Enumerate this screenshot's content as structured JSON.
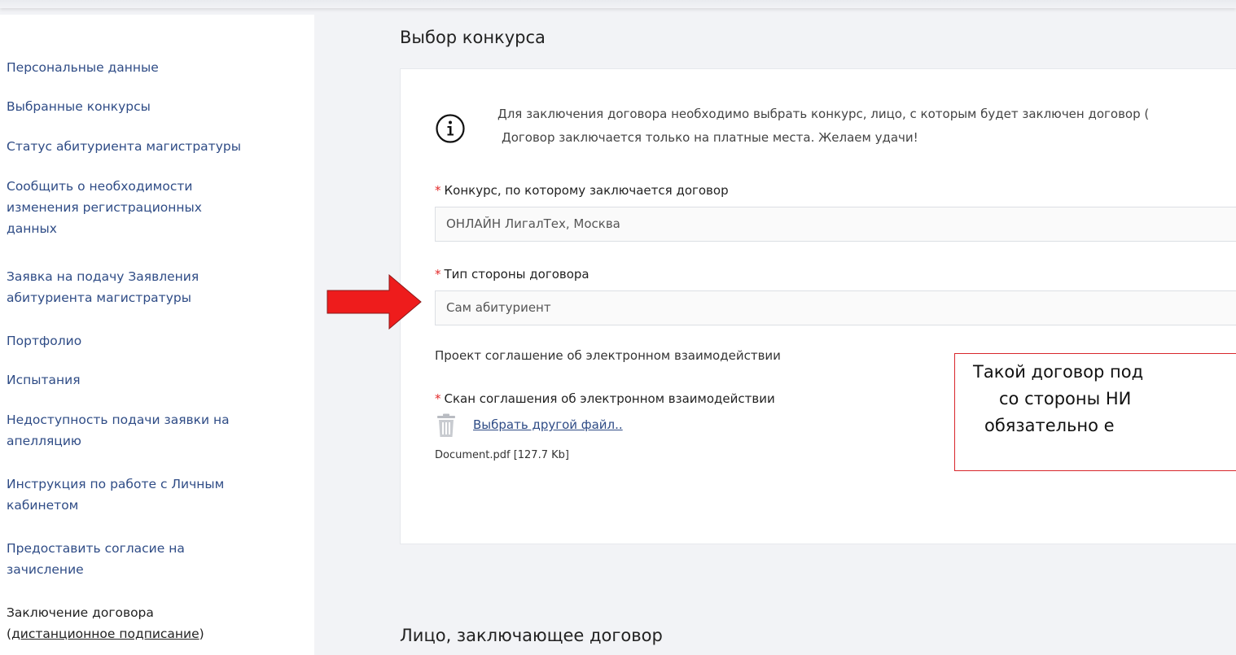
{
  "sidebar": {
    "items": [
      {
        "label": "Персональные данные"
      },
      {
        "label": "Выбранные конкурсы"
      },
      {
        "label": "Статус абитуриента магистратуры"
      },
      {
        "lines": [
          "Сообщить о необходимости",
          "изменения регистрационных",
          "данных"
        ]
      },
      {
        "lines": [
          "Заявка на подачу Заявления",
          "абитуриента магистратуры"
        ]
      },
      {
        "label": "Портфолио"
      },
      {
        "label": "Испытания"
      },
      {
        "lines": [
          "Недоступность подачи заявки на",
          "апелляцию"
        ]
      },
      {
        "lines": [
          "Инструкция по работе с Личным",
          "кабинетом"
        ]
      },
      {
        "lines": [
          "Предоставить согласие на",
          "зачисление"
        ]
      },
      {
        "line1": "Заключение договора",
        "line2_open": "(",
        "line2_link": "дистанционное подписание",
        "line2_close": ")"
      }
    ]
  },
  "main": {
    "section1_title": "Выбор конкурса",
    "info_line1": "Для заключения договора необходимо выбрать конкурс, лицо, с которым будет заключен договор (",
    "info_line2": "Договор заключается только на платные места. Желаем удачи!",
    "required_mark": "*",
    "contest_label": "Конкурс, по которому заключается договор",
    "contest_value": "ОНЛАЙН ЛигалТех, Москва",
    "party_label": "Тип стороны договора",
    "party_value": "Сам абитуриент",
    "agreement_project": "Проект соглашение об электронном взаимодействии",
    "scan_label": "Скан соглашения об электронном взаимодействии",
    "choose_file_link": "Выбрать другой файл..",
    "file_info": "Document.pdf [127.7 Kb]",
    "section2_title": "Лицо, заключающее договор"
  },
  "annotation": {
    "lines": [
      "Такой договор под",
      "со стороны НИ",
      "обязательно е"
    ]
  },
  "colors": {
    "link": "#2f4c86",
    "required": "#e32a2a",
    "arrow": "#ee1c1c",
    "note_border": "#d8262b"
  }
}
